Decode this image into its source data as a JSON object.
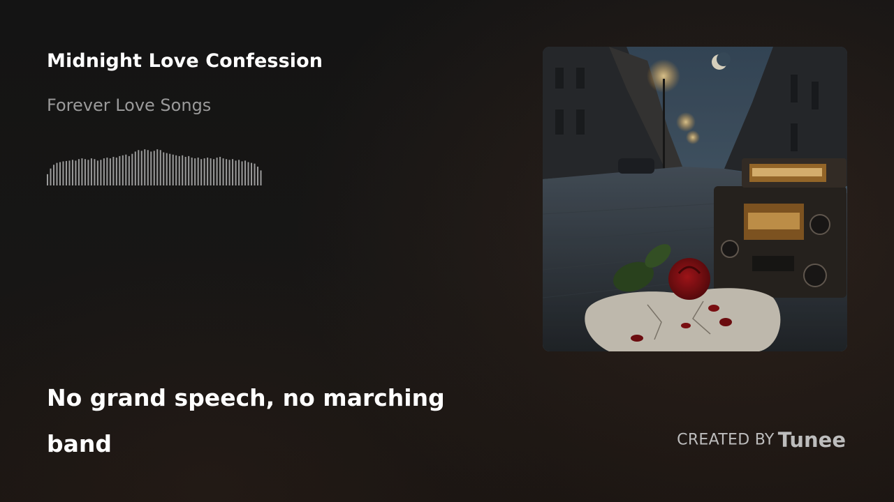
{
  "track": {
    "title": "Midnight Love Confession",
    "album": "Forever Love Songs"
  },
  "lyrics": {
    "current_line": "No grand speech, no marching band"
  },
  "credit": {
    "label": "CREATED BY",
    "brand": "Tunee"
  },
  "waveform": {
    "bar_color": "#9b9b9b",
    "levels": [
      0.3,
      0.45,
      0.55,
      0.6,
      0.62,
      0.64,
      0.65,
      0.66,
      0.68,
      0.66,
      0.7,
      0.72,
      0.7,
      0.68,
      0.72,
      0.7,
      0.66,
      0.68,
      0.72,
      0.74,
      0.72,
      0.76,
      0.74,
      0.78,
      0.8,
      0.82,
      0.78,
      0.84,
      0.9,
      0.94,
      0.92,
      0.96,
      0.94,
      0.9,
      0.92,
      0.96,
      0.94,
      0.88,
      0.86,
      0.84,
      0.82,
      0.8,
      0.78,
      0.8,
      0.76,
      0.78,
      0.74,
      0.72,
      0.74,
      0.7,
      0.72,
      0.74,
      0.72,
      0.7,
      0.74,
      0.76,
      0.72,
      0.7,
      0.68,
      0.7,
      0.66,
      0.68,
      0.64,
      0.66,
      0.62,
      0.6,
      0.58,
      0.5,
      0.4
    ],
    "played_fraction": 0
  },
  "cover_art": {
    "icon": "album-cover-image",
    "description_colors": {
      "sky": "#3e5263",
      "street": "#2e3338",
      "lamp_glow": "#ffd48a",
      "rose": "#8a1014",
      "heart": "#d9d2c4"
    }
  }
}
